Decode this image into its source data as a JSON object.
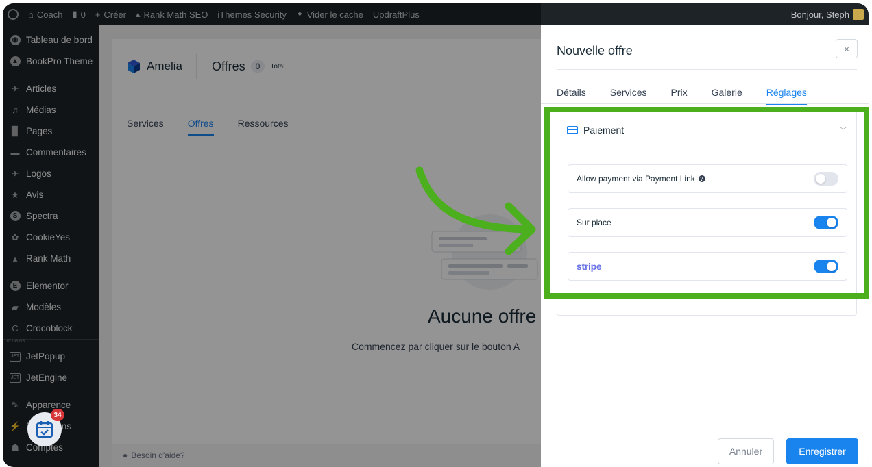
{
  "adminbar": {
    "site_name": "Coach",
    "comments_count": "0",
    "create_label": "Créer",
    "rankmath_label": "Rank Math SEO",
    "ithemes_label": "iThemes Security",
    "cache_label": "Vider le cache",
    "updraft_label": "UpdraftPlus",
    "greeting": "Bonjour, Steph"
  },
  "sidebar": {
    "items": [
      {
        "label": "Tableau de bord",
        "icon": "dashboard-icon"
      },
      {
        "label": "BookPro Theme",
        "icon": "theme-icon"
      },
      {
        "label": "Articles",
        "icon": "pin-icon"
      },
      {
        "label": "Médias",
        "icon": "media-icon"
      },
      {
        "label": "Pages",
        "icon": "page-icon"
      },
      {
        "label": "Commentaires",
        "icon": "comment-icon"
      },
      {
        "label": "Logos",
        "icon": "pin-icon"
      },
      {
        "label": "Avis",
        "icon": "star-icon"
      },
      {
        "label": "Spectra",
        "icon": "spectra-icon"
      },
      {
        "label": "CookieYes",
        "icon": "cookie-icon"
      },
      {
        "label": "Rank Math",
        "icon": "rankmath-icon"
      },
      {
        "label": "Elementor",
        "icon": "elementor-icon"
      },
      {
        "label": "Modèles",
        "icon": "folder-icon"
      },
      {
        "label": "Crocoblock",
        "icon": "crocoblock-icon"
      },
      {
        "label": "JetPopup",
        "icon": "jet-icon"
      },
      {
        "label": "JetEngine",
        "icon": "jet-icon"
      },
      {
        "label": "Apparence",
        "icon": "brush-icon"
      },
      {
        "label": "Extensions",
        "icon": "plugin-icon"
      },
      {
        "label": "Comptes",
        "icon": "user-icon"
      }
    ],
    "plugins_tag": "PLUGINS"
  },
  "amelia": {
    "brand": "Amelia",
    "page_title": "Offres",
    "count": "0",
    "total_label": "Total",
    "tabs": [
      "Services",
      "Offres",
      "Ressources"
    ],
    "active_tab": "Offres",
    "empty_title": "Aucune offre",
    "empty_subtitle": "Commencez par cliquer sur le bouton A",
    "help_label": "Besoin d'aide?"
  },
  "dialog": {
    "title": "Nouvelle offre",
    "close_label": "×",
    "tabs": [
      "Détails",
      "Services",
      "Prix",
      "Galerie",
      "Réglages"
    ],
    "active_tab": "Réglages",
    "payment": {
      "header": "Paiement",
      "options": [
        {
          "label": "Allow payment via Payment Link",
          "enabled": false
        },
        {
          "label": "Sur place",
          "enabled": true
        },
        {
          "label": "stripe",
          "enabled": true
        }
      ]
    },
    "cancel_label": "Annuler",
    "save_label": "Enregistrer"
  },
  "notification": {
    "count": "34"
  },
  "colors": {
    "accent": "#1a84ee",
    "highlight": "#4caf1d",
    "stripe": "#6772e5"
  }
}
